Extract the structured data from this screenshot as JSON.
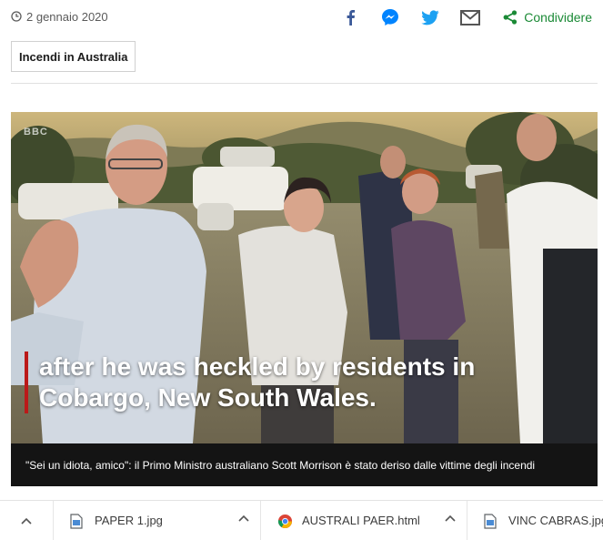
{
  "article": {
    "date": "2 gennaio 2020",
    "share_label": "Condividere",
    "tag": "Incendi in Australia"
  },
  "share_icons": [
    "facebook-icon",
    "messenger-icon",
    "twitter-icon",
    "email-icon",
    "share-icon"
  ],
  "video": {
    "channel_logo": "BBC",
    "subtitle_line1": "after he was heckled by residents in",
    "subtitle_line2": "Cobargo, New South Wales.",
    "caption": "\"Sei un idiota, amico\": il Primo Ministro australiano Scott Morrison è stato deriso dalle vittime degli incendi"
  },
  "downloads": {
    "items": [
      {
        "name": "PAPER 1.jpg",
        "icon": "image-file-icon"
      },
      {
        "name": "AUSTRALI PAER.html",
        "icon": "chrome-icon"
      },
      {
        "name": "VINC CABRAS.jpg",
        "icon": "image-file-icon"
      }
    ]
  },
  "colors": {
    "facebook": "#3b5998",
    "messenger": "#0084ff",
    "twitter": "#1da1f2",
    "share_green": "#1b8a36",
    "subtitle_bar": "#bb1919",
    "caption_bg": "#141414"
  }
}
